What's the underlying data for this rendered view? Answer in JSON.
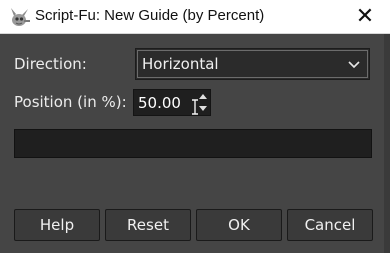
{
  "window": {
    "title": "Script-Fu: New Guide (by Percent)",
    "close_glyph": "✕",
    "app_icon": "gimp-icon"
  },
  "form": {
    "direction_label": "Direction:",
    "direction_value": "Horizontal",
    "position_label": "Position (in %):",
    "position_value": "50.00"
  },
  "progress": {
    "fraction": 0
  },
  "buttons": {
    "help": "Help",
    "reset": "Reset",
    "ok": "OK",
    "cancel": "Cancel"
  },
  "colors": {
    "dialog_bg": "#454545",
    "field_bg": "#1f1f1f",
    "titlebar_bg": "#ffffff"
  }
}
